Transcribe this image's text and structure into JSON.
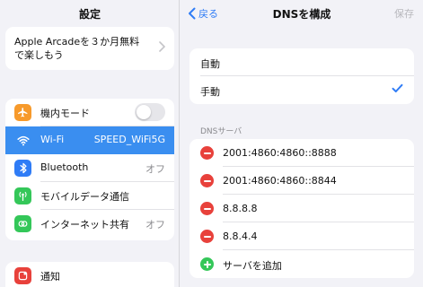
{
  "left_pane": {
    "title": "設定",
    "promo": {
      "text": "Apple Arcadeを３か月無料で楽しもう"
    },
    "rows": [
      {
        "label": "機内モード",
        "icon": "airplane-icon",
        "icon_color": "#f79a2b"
      },
      {
        "label": "Wi-Fi",
        "value": "SPEED_WiFi5G",
        "icon": "wifi-icon",
        "icon_color": "#3a8ef0"
      },
      {
        "label": "Bluetooth",
        "value": "オフ",
        "icon": "bluetooth-icon",
        "icon_color": "#2f7cf6"
      },
      {
        "label": "モバイルデータ通信",
        "icon": "antenna-icon",
        "icon_color": "#34c759"
      },
      {
        "label": "インターネット共有",
        "value": "オフ",
        "icon": "link-icon",
        "icon_color": "#34c759"
      }
    ],
    "notifications": {
      "label": "通知",
      "icon": "notification-icon",
      "icon_color": "#e8413b"
    }
  },
  "right_pane": {
    "back_label": "戻る",
    "title": "DNSを構成",
    "save_label": "保存",
    "modes": [
      {
        "label": "自動"
      },
      {
        "label": "手動",
        "selected": true
      }
    ],
    "section_header": "DNSサーバ",
    "servers": [
      "2001:4860:4860::8888",
      "2001:4860:4860::8844",
      "8.8.8.8",
      "8.8.4.4"
    ],
    "add_server_label": "サーバを追加"
  },
  "colors": {
    "accent": "#2f7cf6",
    "selected_row": "#3a8ef0",
    "delete": "#e8413b",
    "add": "#34c759"
  }
}
